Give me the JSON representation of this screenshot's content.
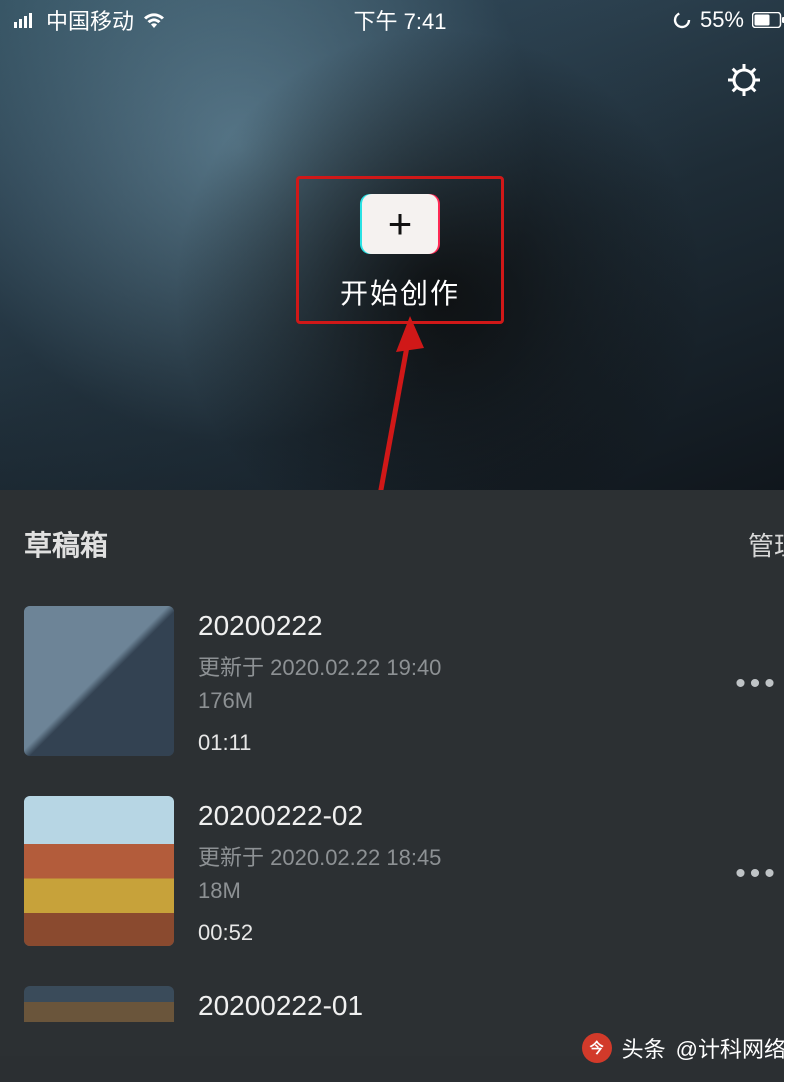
{
  "status_bar": {
    "carrier": "中国移动",
    "time": "下午 7:41",
    "battery_percent": "55%"
  },
  "hero": {
    "create_label": "开始创作"
  },
  "drafts": {
    "title": "草稿箱",
    "manage_label": "管理",
    "items": [
      {
        "title": "20200222",
        "updated_prefix": "更新于",
        "updated_at": "2020.02.22 19:40",
        "size": "176M",
        "duration": "01:11"
      },
      {
        "title": "20200222-02",
        "updated_prefix": "更新于",
        "updated_at": "2020.02.22 18:45",
        "size": "18M",
        "duration": "00:52"
      },
      {
        "title": "20200222-01",
        "updated_prefix": "",
        "updated_at": "",
        "size": "",
        "duration": ""
      }
    ]
  },
  "watermark": {
    "logo_text": "头条",
    "handle": "@计科网络"
  }
}
